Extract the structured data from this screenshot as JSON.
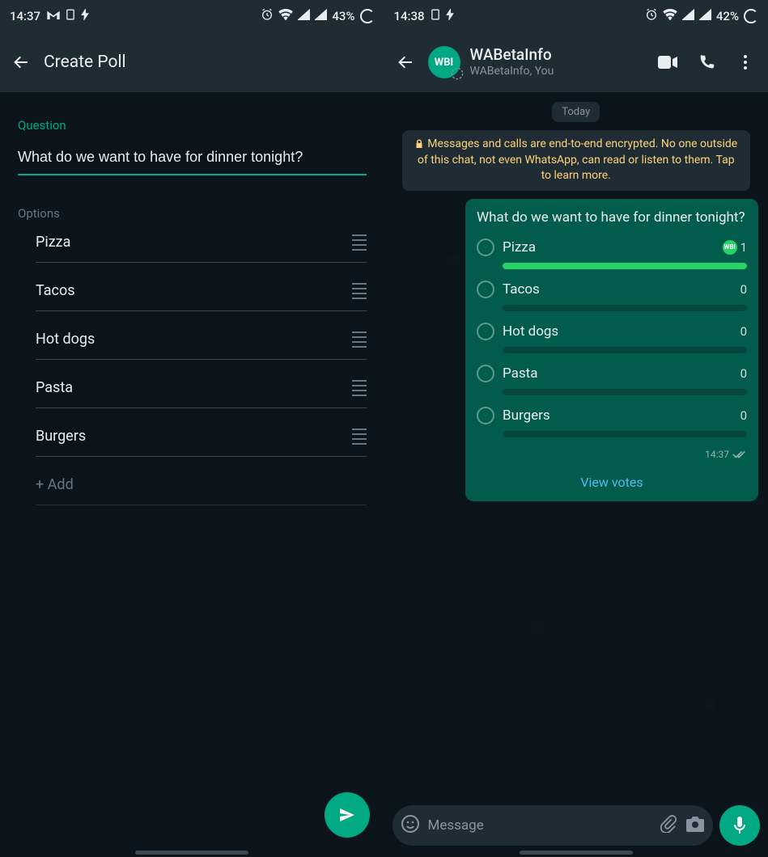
{
  "left": {
    "status": {
      "time": "14:37",
      "battery": "43%"
    },
    "header": {
      "title": "Create Poll"
    },
    "question_label": "Question",
    "question_value": "What do we want to have for dinner tonight?",
    "options_label": "Options",
    "options": [
      "Pizza",
      "Tacos",
      "Hot dogs",
      "Pasta",
      "Burgers"
    ],
    "add_label": "+ Add"
  },
  "right": {
    "status": {
      "time": "14:38",
      "battery": "42%"
    },
    "header": {
      "name": "WABetaInfo",
      "sub": "WABetaInfo, You",
      "avatar": "WBI"
    },
    "date_chip": "Today",
    "encryption_notice": "Messages and calls are end-to-end encrypted. No one outside of this chat, not even WhatsApp, can read or listen to them. Tap to learn more.",
    "poll": {
      "question": "What do we want to have for dinner tonight?",
      "options": [
        {
          "label": "Pizza",
          "votes": 1,
          "pct": 100,
          "selected": false,
          "voter": "WBI"
        },
        {
          "label": "Tacos",
          "votes": 0,
          "pct": 0,
          "selected": false
        },
        {
          "label": "Hot dogs",
          "votes": 0,
          "pct": 0,
          "selected": false
        },
        {
          "label": "Pasta",
          "votes": 0,
          "pct": 0,
          "selected": false
        },
        {
          "label": "Burgers",
          "votes": 0,
          "pct": 0,
          "selected": false
        }
      ],
      "time": "14:37",
      "view_votes_label": "View votes"
    },
    "composer_placeholder": "Message"
  },
  "watermark": "WABETAINFO"
}
